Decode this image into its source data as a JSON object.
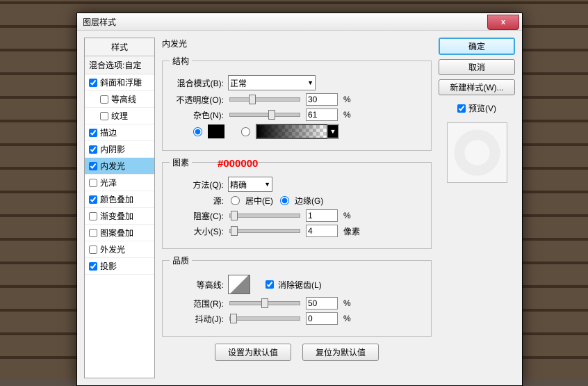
{
  "window": {
    "title": "图层样式",
    "close_icon": "x"
  },
  "styles_panel": {
    "header": "样式",
    "blend_options": "混合选项:自定",
    "items": [
      {
        "label": "斜面和浮雕",
        "checked": true,
        "indent": false
      },
      {
        "label": "等高线",
        "checked": false,
        "indent": true
      },
      {
        "label": "纹理",
        "checked": false,
        "indent": true
      },
      {
        "label": "描边",
        "checked": true,
        "indent": false
      },
      {
        "label": "内阴影",
        "checked": true,
        "indent": false
      },
      {
        "label": "内发光",
        "checked": true,
        "indent": false,
        "selected": true
      },
      {
        "label": "光泽",
        "checked": false,
        "indent": false
      },
      {
        "label": "颜色叠加",
        "checked": true,
        "indent": false
      },
      {
        "label": "渐变叠加",
        "checked": false,
        "indent": false
      },
      {
        "label": "图案叠加",
        "checked": false,
        "indent": false
      },
      {
        "label": "外发光",
        "checked": false,
        "indent": false
      },
      {
        "label": "投影",
        "checked": true,
        "indent": false
      }
    ]
  },
  "panel_title": "内发光",
  "structure": {
    "legend": "结构",
    "blend_mode_label": "混合模式(B):",
    "blend_mode_value": "正常",
    "opacity_label": "不透明度(O):",
    "opacity_value": "30",
    "opacity_unit": "%",
    "noise_label": "杂色(N):",
    "noise_value": "61",
    "noise_unit": "%",
    "color_hex": "#000000",
    "annotation": "#000000"
  },
  "elements": {
    "legend": "图素",
    "technique_label": "方法(Q):",
    "technique_value": "精确",
    "source_label": "源:",
    "source_center": "居中(E)",
    "source_edge": "边缘(G)",
    "source_selected": "edge",
    "choke_label": "阻塞(C):",
    "choke_value": "1",
    "choke_unit": "%",
    "size_label": "大小(S):",
    "size_value": "4",
    "size_unit": "像素"
  },
  "quality": {
    "legend": "品质",
    "contour_label": "等高线:",
    "antialias_label": "消除锯齿(L)",
    "antialias_checked": true,
    "range_label": "范围(R):",
    "range_value": "50",
    "range_unit": "%",
    "jitter_label": "抖动(J):",
    "jitter_value": "0",
    "jitter_unit": "%"
  },
  "footer": {
    "make_default": "设置为默认值",
    "reset_default": "复位为默认值"
  },
  "right": {
    "ok": "确定",
    "cancel": "取消",
    "new_style": "新建样式(W)...",
    "preview_label": "预览(V)",
    "preview_checked": true
  }
}
